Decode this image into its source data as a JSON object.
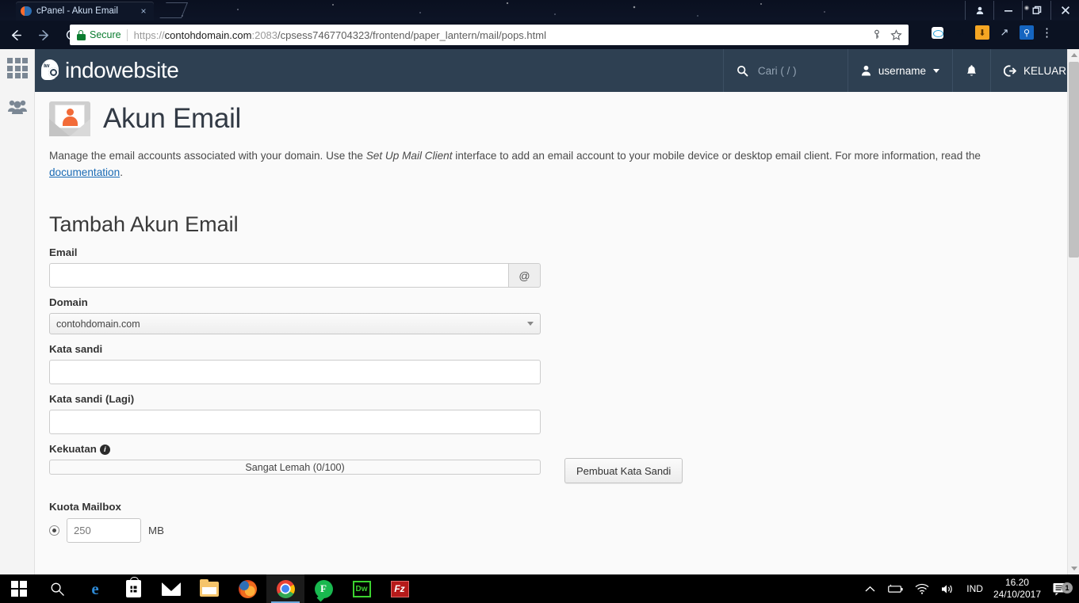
{
  "browser": {
    "tab": {
      "title": "cPanel - Akun Email",
      "favicon": "cpanel-favicon",
      "close_label": "×"
    },
    "new_tab_label": "new-tab",
    "window_controls": {
      "profile": "profile-icon",
      "minimize": "minimize-icon",
      "restore": "restore-icon",
      "close": "close-icon"
    },
    "nav": {
      "back": "back-arrow-icon",
      "forward": "forward-arrow-icon",
      "reload": "reload-icon"
    },
    "omnibox": {
      "security_label": "Secure",
      "lock_icon": "lock-icon",
      "url_prefix": "https://",
      "url_domain": "contohdomain.com",
      "url_port": ":2083",
      "url_path": "/cpsess7467704323/frontend/paper_lantern/mail/pops.html",
      "full_url": "https://contohdomain.com:2083/cpsess7467704323/frontend/paper_lantern/mail/pops.html",
      "pin_icon": "save-password-key-icon",
      "star_icon": "bookmark-star-icon"
    },
    "extensions": [
      {
        "name": "oval-extension-icon",
        "glyph": ""
      },
      {
        "name": "star-sparkle-icon",
        "glyph": "✶"
      },
      {
        "name": "download-extension-icon",
        "glyph": "↓"
      },
      {
        "name": "image-extension-icon",
        "glyph": "↗"
      },
      {
        "name": "search-extension-icon",
        "glyph": "⌕"
      }
    ],
    "menu_icon": "chrome-menu-icon"
  },
  "rail": {
    "items": [
      {
        "name": "apps-grid-icon",
        "label": "Apps"
      },
      {
        "name": "users-group-icon",
        "label": "Users"
      }
    ]
  },
  "cp_header": {
    "brand": "indowebsite",
    "brand_mark_text": "iw",
    "search": {
      "placeholder": "Cari ( / )",
      "icon": "search-icon"
    },
    "user": {
      "label": "username",
      "icon": "user-icon",
      "caret": "chevron-down-icon"
    },
    "notifications_icon": "bell-icon",
    "logout": {
      "label": "KELUAR",
      "icon": "logout-icon"
    }
  },
  "page": {
    "title": "Akun Email",
    "title_icon": "email-account-envelope-icon",
    "description": {
      "part1": "Manage the email accounts associated with your domain. Use the ",
      "emphasis": "Set Up Mail Client",
      "part2": " interface to add an email account to your mobile device or desktop email client. For more information, read the ",
      "link": "documentation",
      "part3": "."
    },
    "section_title": "Tambah Akun Email",
    "fields": {
      "email": {
        "label": "Email",
        "value": "",
        "placeholder": "",
        "addon": "@"
      },
      "domain": {
        "label": "Domain",
        "selected": "contohdomain.com",
        "options": [
          "contohdomain.com"
        ]
      },
      "password": {
        "label": "Kata sandi",
        "value": "",
        "placeholder": ""
      },
      "password_again": {
        "label": "Kata sandi (Lagi)",
        "value": "",
        "placeholder": ""
      },
      "strength": {
        "label": "Kekuatan",
        "info_icon": "info-icon",
        "info_glyph": "i",
        "value": "Sangat Lemah (0/100)",
        "percent": 0
      },
      "generate_button": "Pembuat Kata Sandi",
      "quota": {
        "label": "Kuota Mailbox",
        "value": "250",
        "unit": "MB",
        "radio_selected": true
      }
    }
  },
  "scrollbar": {
    "up": "scroll-up-arrow",
    "down": "scroll-down-arrow"
  },
  "taskbar": {
    "items": [
      {
        "name": "start-button",
        "label": "Start"
      },
      {
        "name": "search-taskbar-icon",
        "label": "Search"
      },
      {
        "name": "edge-icon",
        "label": "Microsoft Edge"
      },
      {
        "name": "store-icon",
        "label": "Microsoft Store"
      },
      {
        "name": "mail-icon",
        "label": "Mail"
      },
      {
        "name": "file-explorer-icon",
        "label": "File Explorer"
      },
      {
        "name": "firefox-icon",
        "label": "Firefox"
      },
      {
        "name": "chrome-icon",
        "label": "Google Chrome"
      },
      {
        "name": "green-app-icon",
        "label": "F"
      },
      {
        "name": "dreamweaver-icon",
        "label": "Dw"
      },
      {
        "name": "filezilla-icon",
        "label": "Fz"
      }
    ],
    "tray": {
      "chevron": "show-hidden-icons-chevron",
      "battery": "battery-icon",
      "wifi": "wifi-icon",
      "volume": "volume-icon",
      "language": "IND",
      "time": "16.20",
      "date": "24/10/2017",
      "notification_count": "1",
      "notification_icon": "action-center-icon"
    }
  }
}
